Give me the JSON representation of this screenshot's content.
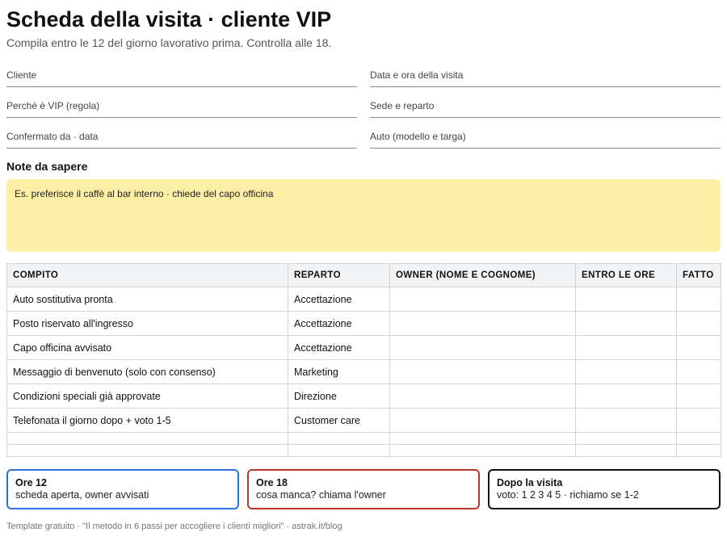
{
  "header": {
    "title": "Scheda della visita · cliente VIP",
    "subtitle": "Compila entro le 12 del giorno lavorativo prima. Controlla alle 18."
  },
  "fields": [
    {
      "label": "Cliente"
    },
    {
      "label": "Data e ora della visita"
    },
    {
      "label": "Perché è VIP (regola)"
    },
    {
      "label": "Sede e reparto"
    },
    {
      "label": "Confermato da · data"
    },
    {
      "label": "Auto (modello e targa)"
    }
  ],
  "notes": {
    "title": "Note da sapere",
    "placeholder": "Es. preferisce il caffè al bar interno · chiede del capo officina"
  },
  "table": {
    "headers": [
      "COMPITO",
      "REPARTO",
      "OWNER (NOME E COGNOME)",
      "ENTRO LE ORE",
      "FATTO"
    ],
    "rows": [
      [
        "Auto sostitutiva pronta",
        "Accettazione",
        "",
        "",
        ""
      ],
      [
        "Posto riservato all'ingresso",
        "Accettazione",
        "",
        "",
        ""
      ],
      [
        "Capo officina avvisato",
        "Accettazione",
        "",
        "",
        ""
      ],
      [
        "Messaggio di benvenuto (solo con consenso)",
        "Marketing",
        "",
        "",
        ""
      ],
      [
        "Condizioni speciali già approvate",
        "Direzione",
        "",
        "",
        ""
      ],
      [
        "Telefonata il giorno dopo + voto 1-5",
        "Customer care",
        "",
        "",
        ""
      ]
    ]
  },
  "cards": [
    {
      "title": "Ore 12",
      "text": "scheda aperta, owner avvisati",
      "color": "#2f6fe0"
    },
    {
      "title": "Ore 18",
      "text": "cosa manca? chiama l'owner",
      "color": "#b8382e"
    },
    {
      "title": "Dopo la visita",
      "text": "voto: 1 2 3 4 5 · richiamo se 1-2",
      "color": "#111111"
    }
  ],
  "footer": "Template gratuito · \"Il metodo in 6 passi per accogliere i clienti migliori\" · astrak.it/blog"
}
